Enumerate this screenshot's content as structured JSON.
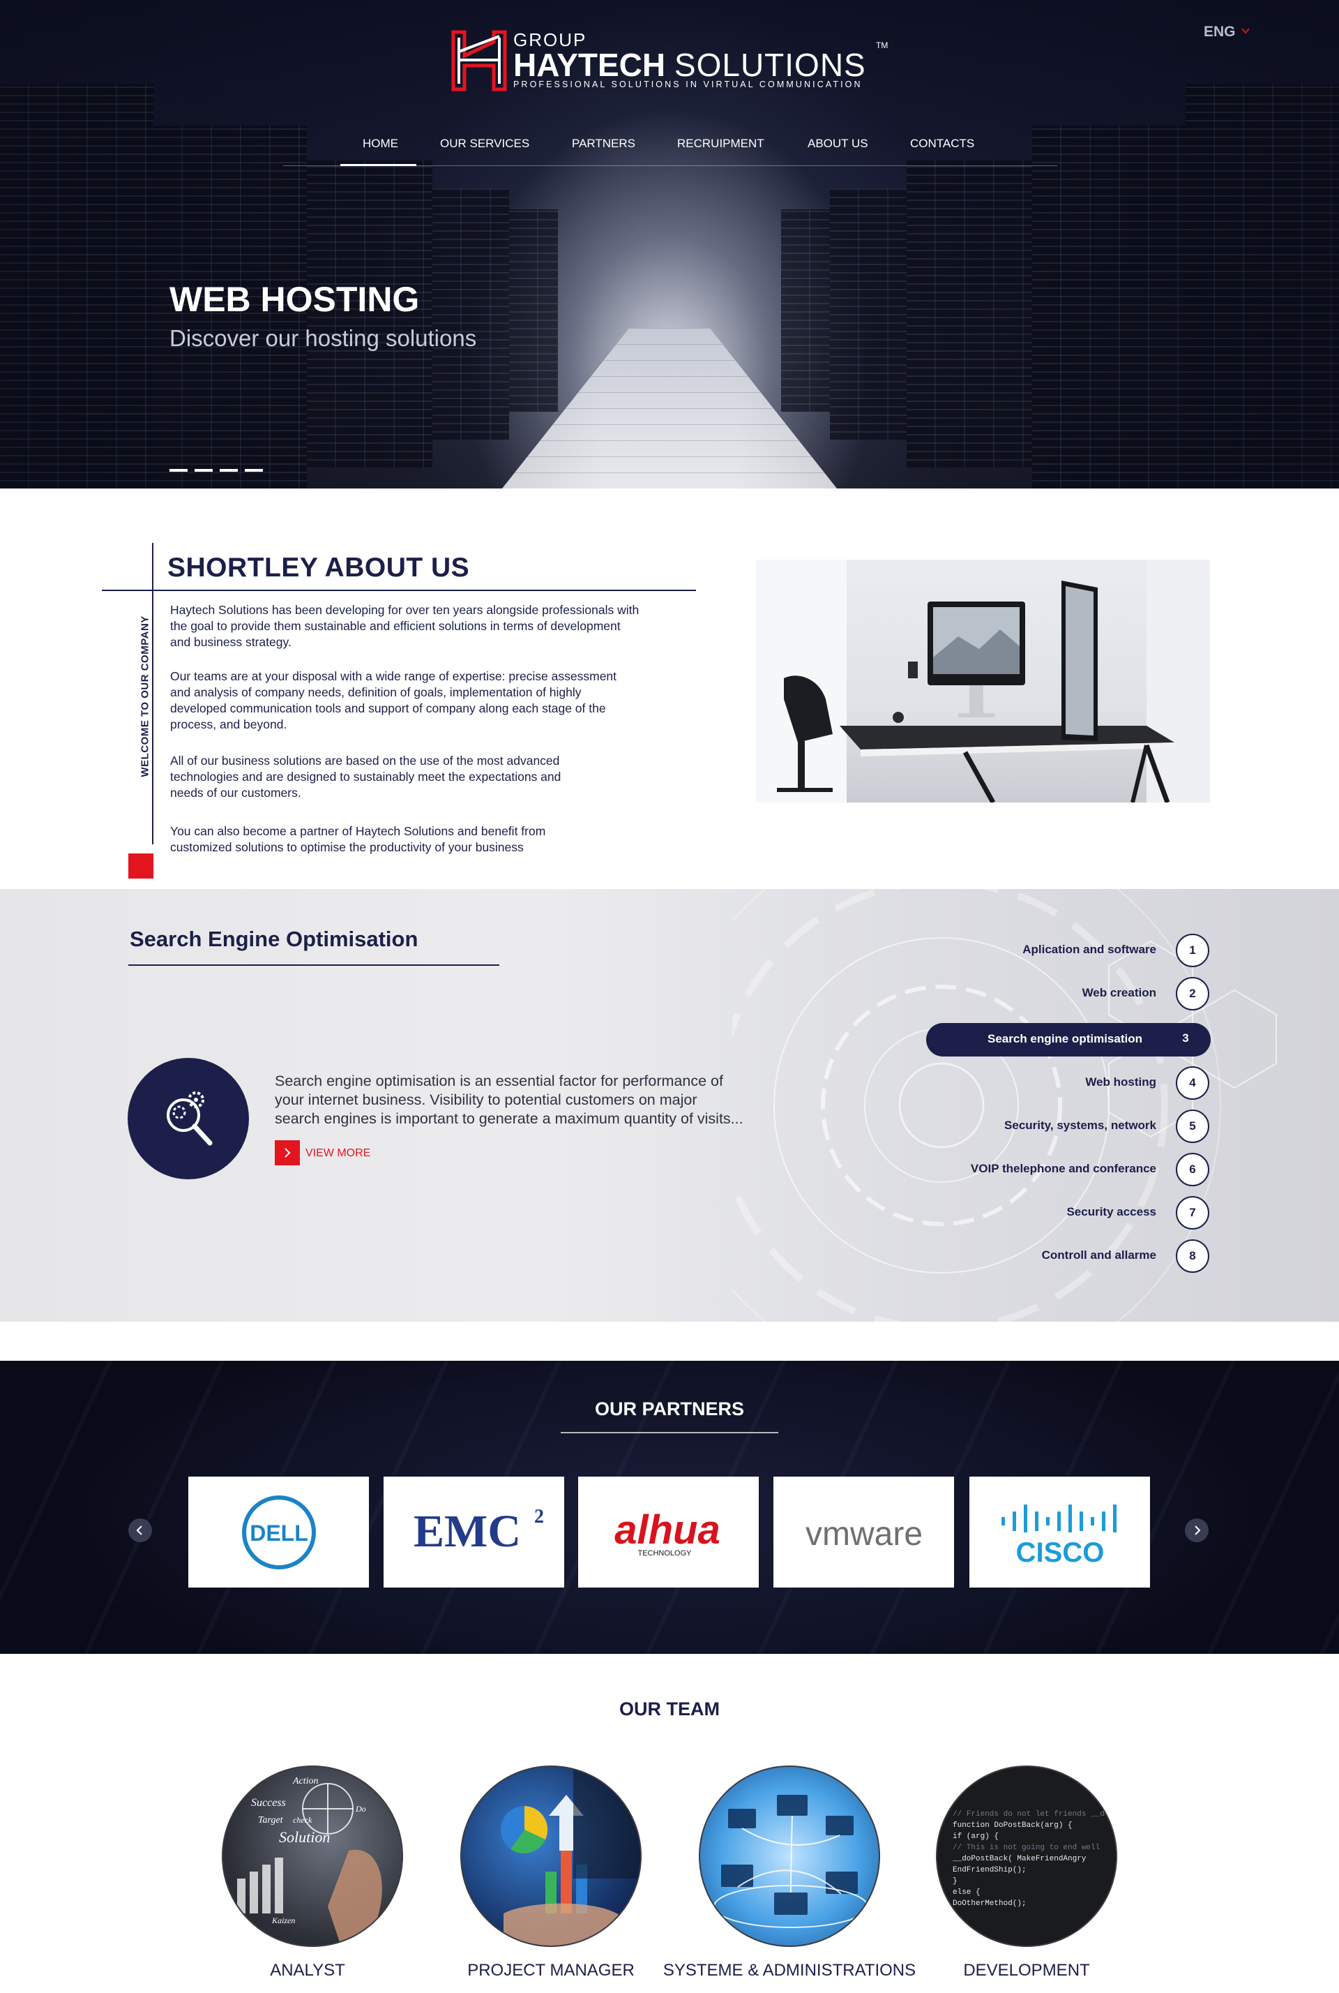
{
  "header": {
    "logo": {
      "group": "GROUP",
      "name_bold": "HAYTECH",
      "name_light": "SOLUTIONS",
      "tm": "TM",
      "tagline": "PROFESSIONAL SOLUTIONS IN VIRTUAL COMMUNICATION"
    },
    "language": "ENG",
    "nav": [
      {
        "label": "HOME",
        "active": true
      },
      {
        "label": "OUR SERVICES"
      },
      {
        "label": "PARTNERS"
      },
      {
        "label": "RECRUIPMENT"
      },
      {
        "label": "ABOUT US"
      },
      {
        "label": "CONTACTS"
      }
    ]
  },
  "hero": {
    "title": "WEB HOSTING",
    "subtitle": "Discover our hosting solutions",
    "slides": 4
  },
  "about": {
    "title": "SHORTLEY ABOUT US",
    "vertical_label": "WELCOME TO OUR COMPANY",
    "paragraphs": [
      [
        "Haytech Solutions has been developing for over ten years alongside professionals with",
        "the goal to provide them sustainable and efficient solutions in terms of development",
        "and business strategy."
      ],
      [
        "Our teams are at your disposal with a wide range of expertise: precise assessment",
        "and analysis of company needs, definition of goals, implementation of highly",
        "developed communication tools and support of company along each stage of the",
        "process, and beyond."
      ],
      [
        "All of our business solutions are based on the use of the most advanced",
        "technologies and are designed to sustainably meet the expectations and",
        "needs of our customers."
      ],
      [
        "You can also become a partner of Haytech Solutions and benefit from",
        "customized solutions to optimise the productivity of your business"
      ]
    ]
  },
  "seo": {
    "title": "Search Engine Optimisation",
    "text_lines": [
      "Search engine optimisation is an essential factor for performance of",
      "your internet business. Visibility to potential customers on major",
      "search engines is important to generate a maximum quantity of visits..."
    ],
    "view_more": "VIEW MORE",
    "services": [
      {
        "label": "Aplication and software",
        "num": "1"
      },
      {
        "label": "Web creation",
        "num": "2"
      },
      {
        "label": "Search engine optimisation",
        "num": "3",
        "active": true
      },
      {
        "label": "Web hosting",
        "num": "4"
      },
      {
        "label": "Security, systems, network",
        "num": "5"
      },
      {
        "label": "VOIP thelephone and conferance",
        "num": "6"
      },
      {
        "label": "Security access",
        "num": "7"
      },
      {
        "label": "Controll and allarme",
        "num": "8"
      }
    ]
  },
  "partners": {
    "title": "OUR PARTNERS",
    "logos": [
      {
        "name": "DELL",
        "color": "#1a84c6"
      },
      {
        "name": "EMC",
        "sup": "2",
        "color": "#243b8b"
      },
      {
        "name": "alhua",
        "sub": "TECHNOLOGY",
        "color": "#d7141e"
      },
      {
        "name": "vmware",
        "color": "#6f6f72"
      },
      {
        "name": "CISCO",
        "color": "#1b9cd8"
      }
    ]
  },
  "team": {
    "title": "OUR TEAM",
    "members": [
      {
        "label": "ANALYST"
      },
      {
        "label": "PROJECT MANAGER"
      },
      {
        "label": "SYSTEME & ADMINISTRATIONS"
      },
      {
        "label": "DEVELOPMENT"
      }
    ],
    "analyst_words": {
      "action": "Action",
      "success": "Success",
      "target": "Target",
      "solution": "Solution",
      "check": "check",
      "kaizen": "Kaizen",
      "do": "Do"
    },
    "code_lines": [
      "// Friends do not let friends __doPost",
      "function DoPostBack(arg) {",
      "  if (arg) {",
      "    // This is not going to end well",
      "    __doPostBack( MakeFriendAngry",
      "    EndFriendShip();",
      "  }",
      "  else {",
      "    DoOtherMethod();",
      "  }",
      "}"
    ]
  },
  "colors": {
    "navy": "#1c1f4a",
    "accent_red": "#e3151f"
  }
}
